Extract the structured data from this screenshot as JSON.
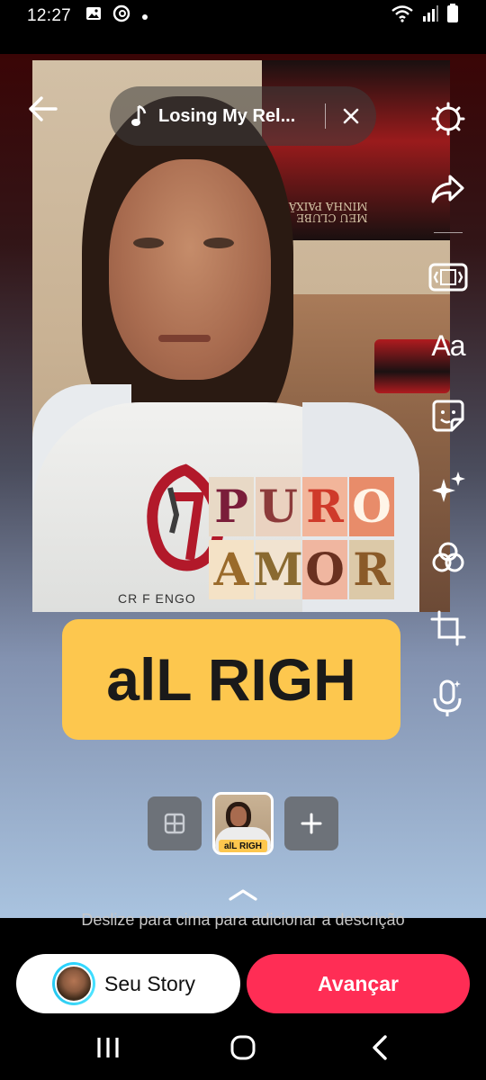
{
  "status_bar": {
    "time": "12:27",
    "left_icons": [
      "image-icon",
      "threads-icon",
      "dot-icon"
    ],
    "right_icons": [
      "wifi-icon",
      "signal-icon",
      "battery-icon"
    ]
  },
  "top_bar": {
    "music_title": "Losing My Rel...",
    "icons": [
      "back-arrow-icon",
      "music-note-icon",
      "close-icon"
    ]
  },
  "tools": {
    "icons": [
      "settings-icon",
      "share-icon",
      "aspect-ratio-icon",
      "text-icon",
      "sticker-icon",
      "effects-icon",
      "filters-icon",
      "crop-icon",
      "voiceover-icon"
    ],
    "text_label": "Aa"
  },
  "photo": {
    "flag_text_line1": "MEU CLUBE",
    "flag_text_line2": "MINHA PAIXÃO",
    "shirt_text": "CR F  ENGO"
  },
  "sticker": {
    "row1": [
      "P",
      "U",
      "R",
      "O"
    ],
    "row2": [
      "A",
      "M",
      "O",
      "R"
    ]
  },
  "text_overlay": "alL RIGH",
  "thumbnails": {
    "current_label": "alL RIGH",
    "add_label": "+"
  },
  "swipe_hint": "Deslize para cima para adicionar a descrição",
  "actions": {
    "your_story": "Seu Story",
    "next": "Avançar"
  },
  "colors": {
    "accent": "#ff2d55",
    "text_pill": "#fdc74e",
    "avatar_ring": "#2bd4ff"
  }
}
